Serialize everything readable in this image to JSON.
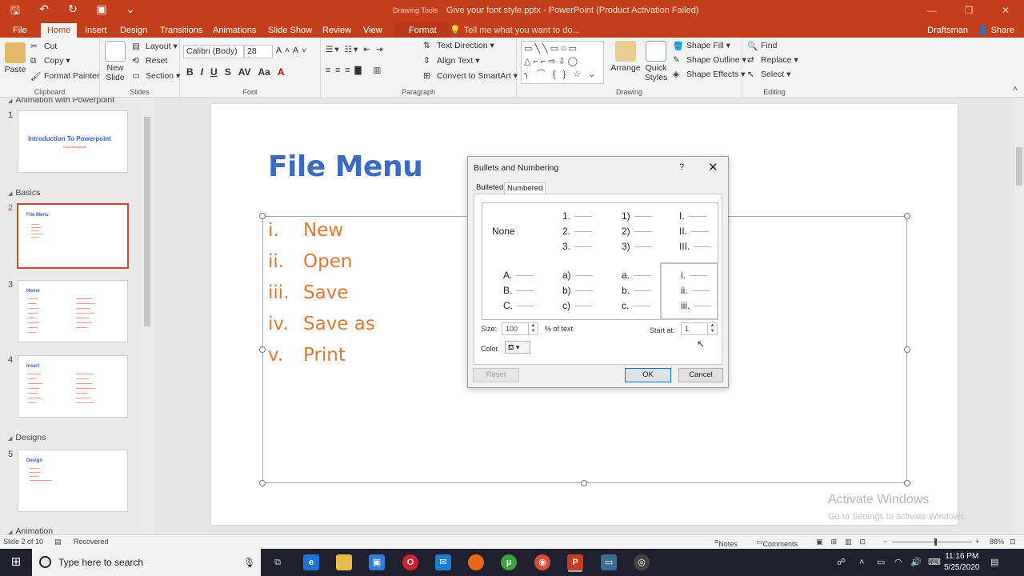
{
  "window": {
    "context_label": "Drawing Tools",
    "title": "Give your font style.pptx - PowerPoint (Product Activation Failed)",
    "controls": [
      "—",
      "❐",
      "✕"
    ]
  },
  "tabs": [
    "File",
    "Home",
    "Insert",
    "Design",
    "Transitions",
    "Animations",
    "Slide Show",
    "Review",
    "View",
    "Format"
  ],
  "tell_me": "Tell me what you want to do...",
  "account": "Draftsman",
  "share": "Share",
  "ribbon": {
    "clipboard": {
      "paste": "Paste",
      "cut": "Cut",
      "copy": "Copy",
      "format_painter": "Format Painter",
      "label": "Clipboard"
    },
    "slides": {
      "new_slide": "New Slide",
      "layout": "Layout",
      "reset": "Reset",
      "section": "Section",
      "label": "Slides"
    },
    "font": {
      "name": "Calibri (Body)",
      "size": "28",
      "label": "Font"
    },
    "paragraph": {
      "text_direction": "Text Direction",
      "align_text": "Align Text",
      "convert": "Convert to SmartArt",
      "label": "Paragraph"
    },
    "drawing": {
      "arrange": "Arrange",
      "quick_styles": "Quick Styles",
      "shape_fill": "Shape Fill",
      "shape_outline": "Shape Outline",
      "shape_effects": "Shape Effects",
      "label": "Drawing"
    },
    "editing": {
      "find": "Find",
      "replace": "Replace",
      "select": "Select",
      "label": "Editing"
    }
  },
  "slides_panel": {
    "sections": [
      "Animation with Powerpoint",
      "Basics",
      "Designs",
      "Animation"
    ],
    "slides": [
      {
        "num": "1",
        "title": "Introduction To Powerpoint",
        "subtitle": "Daud Abdulkadir"
      },
      {
        "num": "2",
        "title": "File Menu"
      },
      {
        "num": "3",
        "title": "Home"
      },
      {
        "num": "4",
        "title": "Insert"
      },
      {
        "num": "5",
        "title": "Design"
      }
    ]
  },
  "slide": {
    "title": "File Menu",
    "items": [
      {
        "num": "i.",
        "text": "New"
      },
      {
        "num": "ii.",
        "text": "Open"
      },
      {
        "num": "iii.",
        "text": "Save"
      },
      {
        "num": "iv.",
        "text": "Save as"
      },
      {
        "num": "v.",
        "text": "Print"
      }
    ]
  },
  "watermark": {
    "line1": "Activate Windows",
    "line2": "Go to Settings to activate Windows."
  },
  "dialog": {
    "title": "Bullets and Numbering",
    "help": "?",
    "close": "✕",
    "tabs": [
      "Bulleted",
      "Numbered"
    ],
    "active_tab": "Numbered",
    "options": [
      {
        "type": "none",
        "label": "None"
      },
      {
        "type": "list",
        "rows": [
          "1.",
          "2.",
          "3."
        ]
      },
      {
        "type": "list",
        "rows": [
          "1)",
          "2)",
          "3)"
        ]
      },
      {
        "type": "list",
        "rows": [
          "I.",
          "II.",
          "III."
        ]
      },
      {
        "type": "list",
        "rows": [
          "A.",
          "B.",
          "C."
        ]
      },
      {
        "type": "list",
        "rows": [
          "a)",
          "b)",
          "c)"
        ]
      },
      {
        "type": "list",
        "rows": [
          "a.",
          "b.",
          "c."
        ]
      },
      {
        "type": "list",
        "rows": [
          "i.",
          "ii.",
          "iii."
        ],
        "selected": true
      }
    ],
    "size_label": "Size:",
    "size_value": "100",
    "size_suffix": "% of text",
    "start_label": "Start at:",
    "start_value": "1",
    "color_label": "Color",
    "reset": "Reset",
    "ok": "OK",
    "cancel": "Cancel"
  },
  "status": {
    "slide_of": "Slide 2 of 10",
    "recovered": "Recovered",
    "notes": "Notes",
    "comments": "Comments",
    "zoom": "88%"
  },
  "taskbar": {
    "search_placeholder": "Type here to search",
    "time": "11:16 PM",
    "date": "5/25/2020"
  },
  "colors": {
    "accent": "#c43e1c",
    "title_blue": "#3a6bc4",
    "list_orange": "#e07a33"
  }
}
